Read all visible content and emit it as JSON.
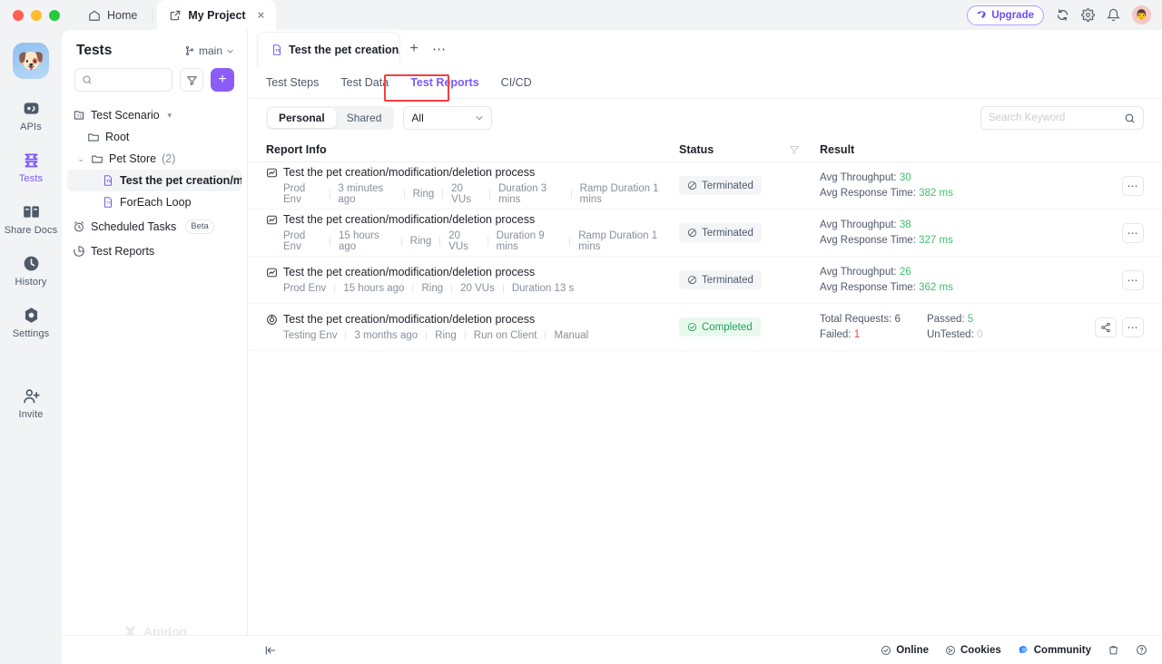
{
  "window": {
    "tabs": [
      {
        "label": "Home",
        "icon": "home-icon",
        "active": false
      },
      {
        "label": "My Project",
        "icon": "project-icon",
        "active": true,
        "close": "×"
      }
    ],
    "upgrade_label": "Upgrade"
  },
  "rail": {
    "avatar_emoji": "🐶",
    "items": [
      {
        "label": "APIs",
        "icon": "apis-icon"
      },
      {
        "label": "Tests",
        "icon": "tests-icon"
      },
      {
        "label": "Share Docs",
        "icon": "share-docs-icon"
      },
      {
        "label": "History",
        "icon": "history-icon"
      },
      {
        "label": "Settings",
        "icon": "settings-icon"
      },
      {
        "label": "Invite",
        "icon": "invite-icon"
      }
    ]
  },
  "sidebar": {
    "title": "Tests",
    "branch": "main",
    "search_placeholder": "",
    "tree": [
      {
        "label": "Test Scenario",
        "icon": "test-scenario-icon",
        "indent": 0,
        "caret": "▾"
      },
      {
        "label": "Root",
        "icon": "folder-icon",
        "indent": 1
      },
      {
        "label": "Pet Store",
        "count": "(2)",
        "icon": "folder-icon",
        "indent": 1,
        "caret": "⌄"
      },
      {
        "label": "Test the pet creation/mo",
        "icon": "ts-file-icon",
        "indent": 2,
        "selected": true
      },
      {
        "label": "ForEach Loop",
        "icon": "ts-file-icon",
        "indent": 2
      },
      {
        "label": "Scheduled Tasks",
        "icon": "clock-icon",
        "indent": 0,
        "badge": "Beta"
      },
      {
        "label": "Test Reports",
        "icon": "report-icon",
        "indent": 0
      }
    ],
    "brand": "Apidog"
  },
  "main": {
    "doc_tab": "Test the pet creation/",
    "subtabs": [
      {
        "label": "Test Steps",
        "active": false
      },
      {
        "label": "Test Data",
        "active": false
      },
      {
        "label": "Test Reports",
        "active": true,
        "highlighted": true
      },
      {
        "label": "CI/CD",
        "active": false
      }
    ],
    "segment": [
      {
        "label": "Personal",
        "on": true
      },
      {
        "label": "Shared",
        "on": false
      }
    ],
    "type_filter": "All",
    "search_placeholder": "Search Keyword",
    "columns": {
      "info": "Report Info",
      "status": "Status",
      "result": "Result"
    },
    "rows": [
      {
        "icon": "performance-report-icon",
        "title": "Test the pet creation/modification/deletion process",
        "meta": [
          "Prod Env",
          "3 minutes ago",
          "Ring",
          "20 VUs",
          "Duration 3 mins",
          "Ramp Duration 1 mins"
        ],
        "status": {
          "label": "Terminated",
          "kind": "terminated",
          "icon": "forbidden-icon"
        },
        "result": [
          {
            "key": "Avg Throughput:",
            "value": "30",
            "tone": "green"
          },
          {
            "key": "Avg Response Time:",
            "value": "382 ms",
            "tone": "green"
          }
        ],
        "actions": [
          "more-icon"
        ]
      },
      {
        "icon": "performance-report-icon",
        "title": "Test the pet creation/modification/deletion process",
        "meta": [
          "Prod Env",
          "15 hours ago",
          "Ring",
          "20 VUs",
          "Duration 9 mins",
          "Ramp Duration 1 mins"
        ],
        "status": {
          "label": "Terminated",
          "kind": "terminated",
          "icon": "forbidden-icon"
        },
        "result": [
          {
            "key": "Avg Throughput:",
            "value": "38",
            "tone": "green"
          },
          {
            "key": "Avg Response Time:",
            "value": "327 ms",
            "tone": "green"
          }
        ],
        "actions": [
          "more-icon"
        ]
      },
      {
        "icon": "performance-report-icon",
        "title": "Test the pet creation/modification/deletion process",
        "meta": [
          "Prod Env",
          "15 hours ago",
          "Ring",
          "20 VUs",
          "Duration 13 s"
        ],
        "status": {
          "label": "Terminated",
          "kind": "terminated",
          "icon": "forbidden-icon"
        },
        "result": [
          {
            "key": "Avg Throughput:",
            "value": "26",
            "tone": "green"
          },
          {
            "key": "Avg Response Time:",
            "value": "362 ms",
            "tone": "green"
          }
        ],
        "actions": [
          "more-icon"
        ]
      },
      {
        "icon": "target-report-icon",
        "title": "Test the pet creation/modification/deletion process",
        "meta": [
          "Testing Env",
          "3 months ago",
          "Ring",
          "Run on Client",
          "Manual"
        ],
        "status": {
          "label": "Completed",
          "kind": "completed",
          "icon": "check-circle-icon"
        },
        "result_pairs": [
          [
            {
              "key": "Total Requests:",
              "value": "6",
              "tone": "dark"
            },
            {
              "key": "Passed:",
              "value": "5",
              "tone": "green"
            }
          ],
          [
            {
              "key": "Failed:",
              "value": "1",
              "tone": "red"
            },
            {
              "key": "UnTested:",
              "value": "0",
              "tone": "muted"
            }
          ]
        ],
        "actions": [
          "share-icon",
          "more-icon"
        ]
      }
    ]
  },
  "statusbar": {
    "collapse_icon": "collapse-panel-icon",
    "items": [
      {
        "label": "Online",
        "icon": "online-icon"
      },
      {
        "label": "Cookies",
        "icon": "cookies-icon"
      },
      {
        "label": "Community",
        "icon": "community-icon"
      }
    ],
    "trailing_icons": [
      "trash-icon",
      "help-icon"
    ]
  },
  "colors": {
    "accent": "#7a5af8",
    "success": "#3fbf6d",
    "danger": "#f53f3f",
    "highlight_box": "#f53f3f"
  }
}
